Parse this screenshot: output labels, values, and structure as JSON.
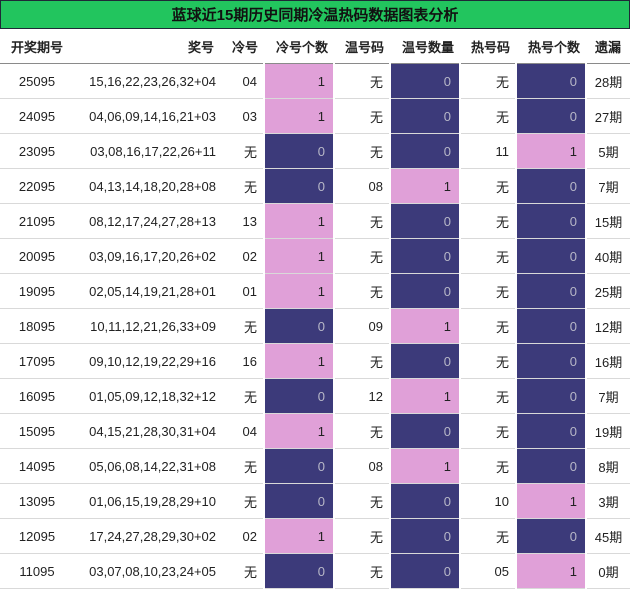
{
  "title": "蓝球近15期历史同期冷温热码数据图表分析",
  "headers": [
    "开奖期号",
    "奖号",
    "冷号",
    "冷号个数",
    "温号码",
    "温号数量",
    "热号码",
    "热号个数",
    "遗漏"
  ],
  "colors": {
    "pink": "#e0a0d8",
    "navy": "#3c3a7a",
    "title_bg": "#22c55e"
  },
  "rows": [
    {
      "issue": "25095",
      "award": "15,16,22,23,26,32+04",
      "cold": "04",
      "cold_n": "1",
      "warm": "无",
      "warm_n": "0",
      "hot": "无",
      "hot_n": "0",
      "miss": "28期"
    },
    {
      "issue": "24095",
      "award": "04,06,09,14,16,21+03",
      "cold": "03",
      "cold_n": "1",
      "warm": "无",
      "warm_n": "0",
      "hot": "无",
      "hot_n": "0",
      "miss": "27期"
    },
    {
      "issue": "23095",
      "award": "03,08,16,17,22,26+11",
      "cold": "无",
      "cold_n": "0",
      "warm": "无",
      "warm_n": "0",
      "hot": "11",
      "hot_n": "1",
      "miss": "5期"
    },
    {
      "issue": "22095",
      "award": "04,13,14,18,20,28+08",
      "cold": "无",
      "cold_n": "0",
      "warm": "08",
      "warm_n": "1",
      "hot": "无",
      "hot_n": "0",
      "miss": "7期"
    },
    {
      "issue": "21095",
      "award": "08,12,17,24,27,28+13",
      "cold": "13",
      "cold_n": "1",
      "warm": "无",
      "warm_n": "0",
      "hot": "无",
      "hot_n": "0",
      "miss": "15期"
    },
    {
      "issue": "20095",
      "award": "03,09,16,17,20,26+02",
      "cold": "02",
      "cold_n": "1",
      "warm": "无",
      "warm_n": "0",
      "hot": "无",
      "hot_n": "0",
      "miss": "40期"
    },
    {
      "issue": "19095",
      "award": "02,05,14,19,21,28+01",
      "cold": "01",
      "cold_n": "1",
      "warm": "无",
      "warm_n": "0",
      "hot": "无",
      "hot_n": "0",
      "miss": "25期"
    },
    {
      "issue": "18095",
      "award": "10,11,12,21,26,33+09",
      "cold": "无",
      "cold_n": "0",
      "warm": "09",
      "warm_n": "1",
      "hot": "无",
      "hot_n": "0",
      "miss": "12期"
    },
    {
      "issue": "17095",
      "award": "09,10,12,19,22,29+16",
      "cold": "16",
      "cold_n": "1",
      "warm": "无",
      "warm_n": "0",
      "hot": "无",
      "hot_n": "0",
      "miss": "16期"
    },
    {
      "issue": "16095",
      "award": "01,05,09,12,18,32+12",
      "cold": "无",
      "cold_n": "0",
      "warm": "12",
      "warm_n": "1",
      "hot": "无",
      "hot_n": "0",
      "miss": "7期"
    },
    {
      "issue": "15095",
      "award": "04,15,21,28,30,31+04",
      "cold": "04",
      "cold_n": "1",
      "warm": "无",
      "warm_n": "0",
      "hot": "无",
      "hot_n": "0",
      "miss": "19期"
    },
    {
      "issue": "14095",
      "award": "05,06,08,14,22,31+08",
      "cold": "无",
      "cold_n": "0",
      "warm": "08",
      "warm_n": "1",
      "hot": "无",
      "hot_n": "0",
      "miss": "8期"
    },
    {
      "issue": "13095",
      "award": "01,06,15,19,28,29+10",
      "cold": "无",
      "cold_n": "0",
      "warm": "无",
      "warm_n": "0",
      "hot": "10",
      "hot_n": "1",
      "miss": "3期"
    },
    {
      "issue": "12095",
      "award": "17,24,27,28,29,30+02",
      "cold": "02",
      "cold_n": "1",
      "warm": "无",
      "warm_n": "0",
      "hot": "无",
      "hot_n": "0",
      "miss": "45期"
    },
    {
      "issue": "11095",
      "award": "03,07,08,10,23,24+05",
      "cold": "无",
      "cold_n": "0",
      "warm": "无",
      "warm_n": "0",
      "hot": "05",
      "hot_n": "1",
      "miss": "0期"
    }
  ]
}
